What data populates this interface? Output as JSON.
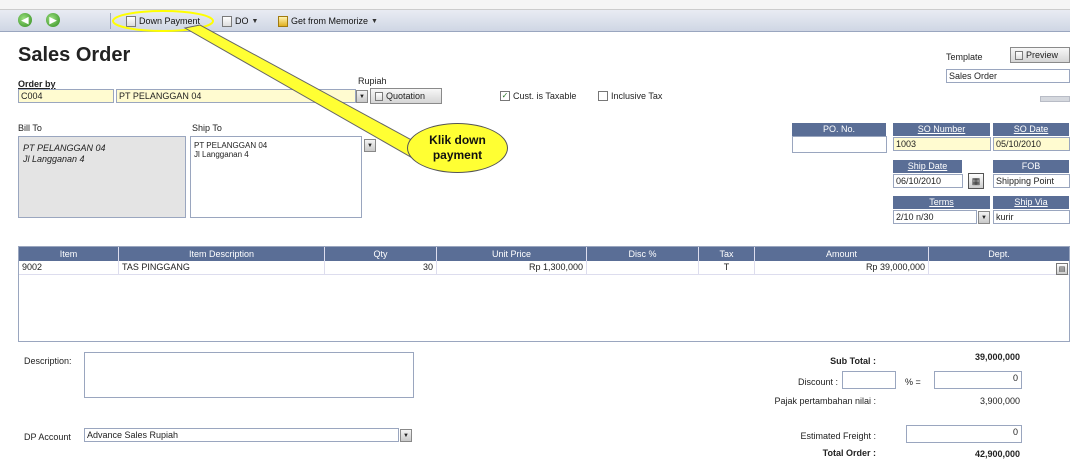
{
  "toolbar": {
    "down_payment": "Down Payment",
    "do": "DO",
    "get_from_memorize": "Get from Memorize"
  },
  "header": {
    "title": "Sales Order",
    "order_by_label": "Order by",
    "customer_code": "C004",
    "customer_name": "PT PELANGGAN 04",
    "currency": "Rupiah",
    "quotation_button": "Quotation",
    "cust_taxable_label": "Cust. is Taxable",
    "cust_taxable_checked": true,
    "inclusive_tax_label": "Inclusive Tax",
    "inclusive_tax_checked": false,
    "template_label": "Template",
    "template_value": "Sales Order",
    "preview_button": "Preview"
  },
  "address": {
    "bill_to_label": "Bill To",
    "bill_to_line1": "PT PELANGGAN 04",
    "bill_to_line2": "Jl Langganan 4",
    "ship_to_label": "Ship To",
    "ship_to_line1": "PT PELANGGAN 04",
    "ship_to_line2": "Jl Langganan 4"
  },
  "so_info": {
    "po_no_label": "PO. No.",
    "po_no_value": "",
    "so_number_label": "SO Number",
    "so_number_value": "1003",
    "so_date_label": "SO Date",
    "so_date_value": "05/10/2010",
    "ship_date_label": "Ship Date",
    "ship_date_value": "06/10/2010",
    "fob_label": "FOB",
    "fob_value": "Shipping Point",
    "terms_label": "Terms",
    "terms_value": "2/10 n/30",
    "ship_via_label": "Ship Via",
    "ship_via_value": "kurir"
  },
  "grid": {
    "columns": [
      "Item",
      "Item Description",
      "Qty",
      "Unit Price",
      "Disc %",
      "Tax",
      "Amount",
      "Dept."
    ],
    "rows": [
      [
        "9002",
        "TAS PINGGANG",
        "30",
        "Rp 1,300,000",
        "",
        "T",
        "Rp 39,000,000",
        ""
      ]
    ]
  },
  "footer": {
    "description_label": "Description:",
    "description_value": "",
    "dp_account_label": "DP Account",
    "dp_account_value": "Advance Sales Rupiah",
    "sub_total_label": "Sub Total :",
    "sub_total_value": "39,000,000",
    "discount_label": "Discount :",
    "discount_pct": "",
    "pct_eq": "% =",
    "discount_value": "0",
    "ppn_label": "Pajak pertambahan nilai :",
    "ppn_value": "3,900,000",
    "freight_label": "Estimated Freight :",
    "freight_value": "0",
    "total_label": "Total Order :",
    "total_value": "42,900,000"
  },
  "annotation": {
    "line1": "Klik down",
    "line2": "payment",
    "color": "#ffff33"
  },
  "colors": {
    "header_blue": "#5a6e96",
    "field_yellow": "#fffbd0"
  }
}
